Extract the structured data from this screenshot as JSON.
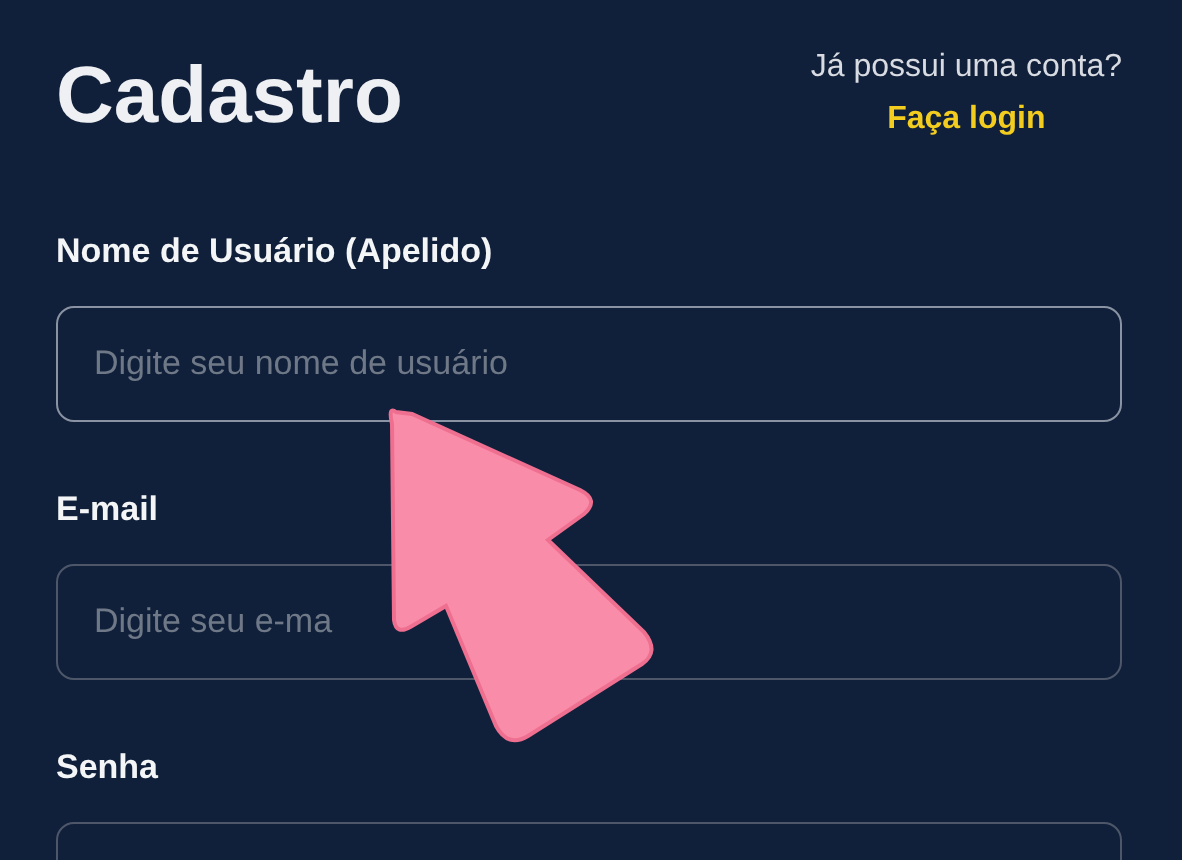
{
  "title": "Cadastro",
  "login_prompt": {
    "text": "Já possui uma conta?",
    "link": "Faça login"
  },
  "fields": [
    {
      "label": "Nome de Usuário (Apelido)",
      "placeholder": "Digite seu nome de usuário"
    },
    {
      "label": "E-mail",
      "placeholder": "Digite seu e-ma"
    },
    {
      "label": "Senha"
    }
  ]
}
